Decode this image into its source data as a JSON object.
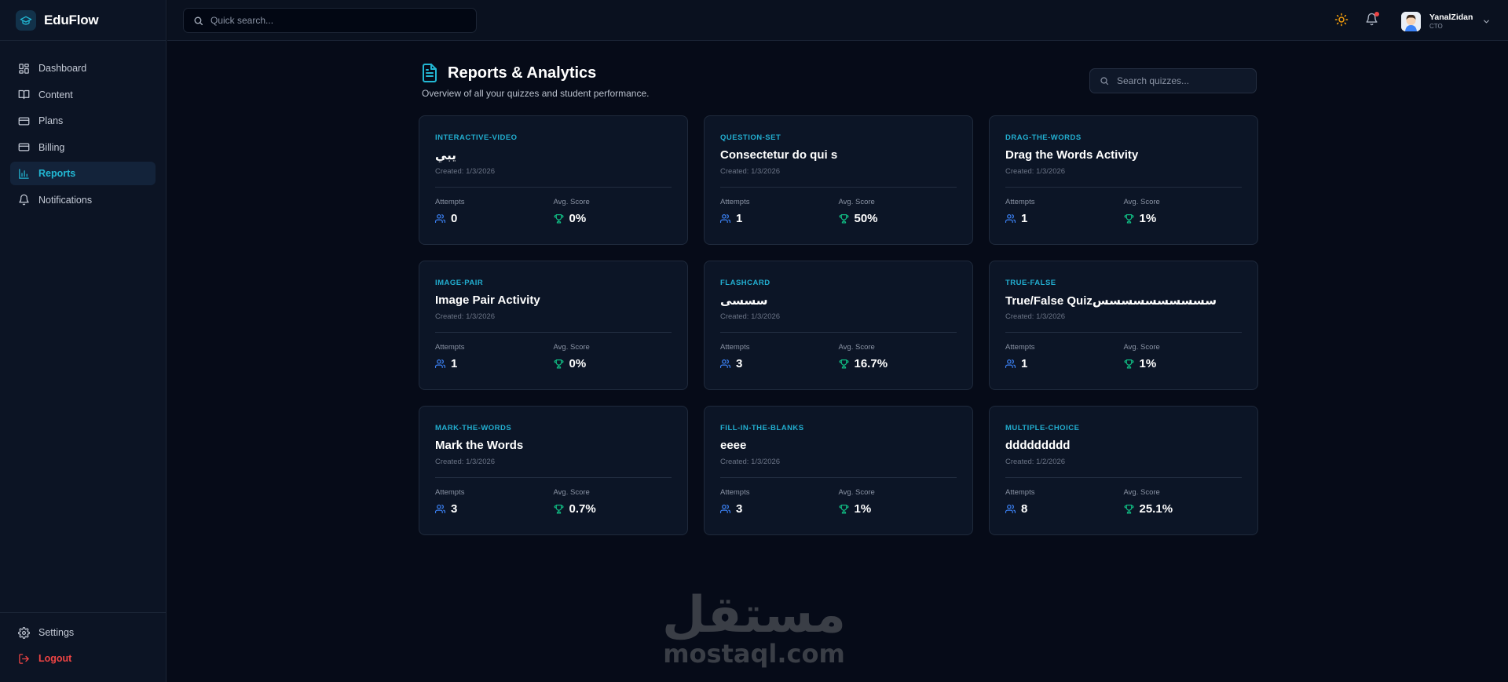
{
  "app": {
    "name": "EduFlow"
  },
  "colors": {
    "accent": "#22b8d4",
    "danger": "#ef4444",
    "success": "#10b981",
    "people": "#3b82f6",
    "sun": "#f59e0b"
  },
  "sidebar": {
    "items": [
      {
        "label": "Dashboard",
        "icon": "dashboard-icon"
      },
      {
        "label": "Content",
        "icon": "book-icon"
      },
      {
        "label": "Plans",
        "icon": "card-icon"
      },
      {
        "label": "Billing",
        "icon": "card-icon"
      },
      {
        "label": "Reports",
        "icon": "bar-chart-icon",
        "active": true
      },
      {
        "label": "Notifications",
        "icon": "bell-icon"
      }
    ],
    "bottom": [
      {
        "label": "Settings",
        "icon": "gear-icon"
      },
      {
        "label": "Logout",
        "icon": "logout-icon"
      }
    ]
  },
  "topbar": {
    "search_placeholder": "Quick search...",
    "user": {
      "name": "YanalZidan",
      "role": "CTO"
    }
  },
  "page": {
    "title": "Reports & Analytics",
    "subtitle": "Overview of all your quizzes and student performance.",
    "search_placeholder": "Search quizzes...",
    "attempts_label": "Attempts",
    "avg_label": "Avg. Score"
  },
  "cards": [
    {
      "type": "INTERACTIVE-VIDEO",
      "title": "يبي",
      "created": "Created: 1/3/2026",
      "attempts": "0",
      "avg": "0%"
    },
    {
      "type": "QUESTION-SET",
      "title": "Consectetur do qui s",
      "created": "Created: 1/3/2026",
      "attempts": "1",
      "avg": "50%"
    },
    {
      "type": "DRAG-THE-WORDS",
      "title": "Drag the Words Activity",
      "created": "Created: 1/3/2026",
      "attempts": "1",
      "avg": "1%"
    },
    {
      "type": "IMAGE-PAIR",
      "title": "Image Pair Activity",
      "created": "Created: 1/3/2026",
      "attempts": "1",
      "avg": "0%"
    },
    {
      "type": "FLASHCARD",
      "title": "سسسى",
      "created": "Created: 1/3/2026",
      "attempts": "3",
      "avg": "16.7%"
    },
    {
      "type": "TRUE-FALSE",
      "title": "True/False Quizسسسسسسسسسس",
      "created": "Created: 1/3/2026",
      "attempts": "1",
      "avg": "1%"
    },
    {
      "type": "MARK-THE-WORDS",
      "title": "Mark the Words",
      "created": "Created: 1/3/2026",
      "attempts": "3",
      "avg": "0.7%"
    },
    {
      "type": "FILL-IN-THE-BLANKS",
      "title": "eeee",
      "created": "Created: 1/3/2026",
      "attempts": "3",
      "avg": "1%"
    },
    {
      "type": "MULTIPLE-CHOICE",
      "title": "ddddddddd",
      "created": "Created: 1/2/2026",
      "attempts": "8",
      "avg": "25.1%"
    }
  ],
  "watermark": {
    "arabic": "مستقل",
    "latin": "mostaql.com"
  }
}
